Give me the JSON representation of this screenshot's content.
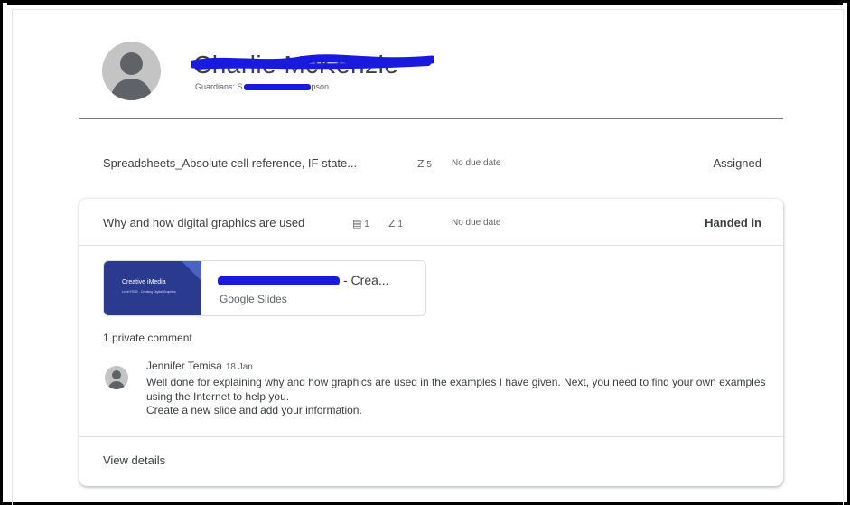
{
  "student": {
    "name": "Charlie McKenzie",
    "guardians_prefix": "Guardians: S",
    "guardians_suffix": "pson"
  },
  "assignments": [
    {
      "title": "Spreadsheets_Absolute cell reference, IF state...",
      "attachments": "5",
      "due": "No due date",
      "status": "Assigned"
    },
    {
      "title": "Why and how digital graphics are used",
      "comments": "1",
      "attachments": "1",
      "due": "No due date",
      "status": "Handed in",
      "attachment": {
        "thumb_title": "Creative iMedia",
        "thumb_subtitle": "Level R082 - Creating Digital Graphics",
        "title_suffix": "- Crea...",
        "type": "Google Slides"
      },
      "private_comment_label": "1 private comment",
      "comment": {
        "author": "Jennifer Temisa",
        "date": "18 Jan",
        "line1": "Well done for explaining why and how graphics are used in the examples I have given.  Next, you need to find your own  examples using the Internet to help you.",
        "line2": "Create a new slide and add your information."
      },
      "view_details": "View details"
    }
  ],
  "icons": {
    "attachment": "paperclip-icon",
    "comment": "comment-icon",
    "avatar": "person-icon"
  },
  "colors": {
    "redaction": "#1a1adf",
    "thumbnail": "#2a3b8f"
  }
}
